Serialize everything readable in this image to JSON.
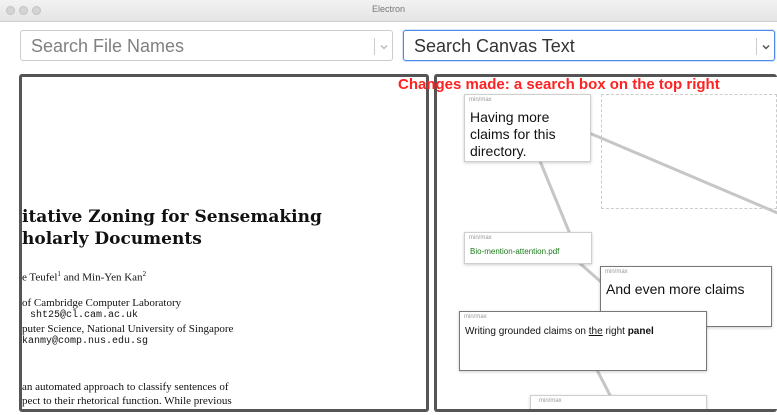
{
  "window": {
    "title": "Electron"
  },
  "search": {
    "file_names_placeholder": "Search File Names",
    "canvas_text_value": "Search Canvas Text"
  },
  "pdf": {
    "title_line1": "itative Zoning for Sensemaking",
    "title_line2": "holarly Documents",
    "authors_text": "e Teufel",
    "author1_sup": "1",
    "authors_join": " and Min-Yen Kan",
    "author2_sup": "2",
    "affil1": "of Cambridge Computer Laboratory",
    "email1": "sht25@cl.cam.ac.uk",
    "affil2": "puter Science, National University of Singapore",
    "email2": "kanmy@comp.nus.edu.sg",
    "abstract1": "an automated approach to classify sentences of",
    "abstract2": "pect to their rhetorical function. While previous"
  },
  "canvas": {
    "annotation": "Changes made: a search box on the top right",
    "minmax_label": "min/max",
    "card1_text": "Having more claims for this directory.",
    "card2_file": "Bio-mention-attention.pdf",
    "card3_text": "And even more claims",
    "card4_pre": "Writing grounded claims on ",
    "card4_the": "the",
    "card4_mid": " right ",
    "card4_bold": "panel"
  },
  "colors": {
    "annotation": "#ff2222",
    "file_link": "#1a7a1a",
    "focus_border": "#4c8be8",
    "pane_border": "#555555"
  }
}
